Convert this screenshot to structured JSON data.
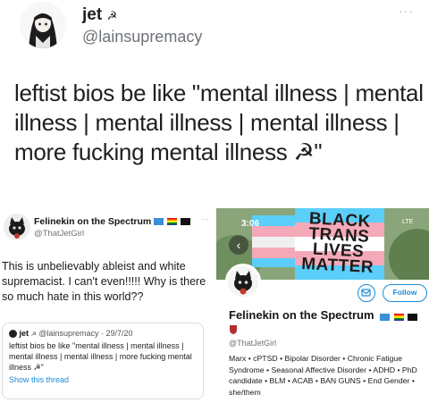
{
  "top_tweet": {
    "name": "jet",
    "name_symbol": "☭",
    "handle": "@lainsupremacy",
    "more_icon": "more-dots-icon",
    "body": "leftist bios be like \"mental illness | mental illness | mental illness | mental illness | more fucking mental illness ☭\""
  },
  "left_shot": {
    "name": "Felinekin on the Spectrum",
    "name_suffix": "🇺🇳 ▬ ■▬ ..",
    "handle": "@ThatJetGirl",
    "more": "···",
    "body": "This is unbelievably ableist and white supremacist. I can't even!!!!! Why is there so much hate in this world??",
    "quote": {
      "name": "jet",
      "symbol": "☭",
      "handle": "@lainsupremacy",
      "date": "· 29/7/20",
      "body": "leftist bios be like \"mental illness | mental illness | mental illness | mental illness | more fucking mental illness ☭\"",
      "link": "Show this thread"
    }
  },
  "right_shot": {
    "status_time": "3:06",
    "status_network": "LTE",
    "sign_lines": [
      "BLACK",
      "TRANS",
      "LIVES",
      "MATTER"
    ],
    "follow_label": "Follow",
    "name": "Felinekin on the Spectrum",
    "handle": "@ThatJetGirl",
    "bio": "Marx • cPTSD • Bipolar Disorder • Chronic Fatigue Syndrome • Seasonal Affective Disorder • ADHD • PhD candidate • BLM • ACAB • BAN GUNS • End Gender • she/them"
  },
  "colors": {
    "link_blue": "#1d8ad6",
    "trans_blue": "#5bcefa",
    "trans_pink": "#f5a9b8",
    "handle_gray": "#6e7378"
  }
}
